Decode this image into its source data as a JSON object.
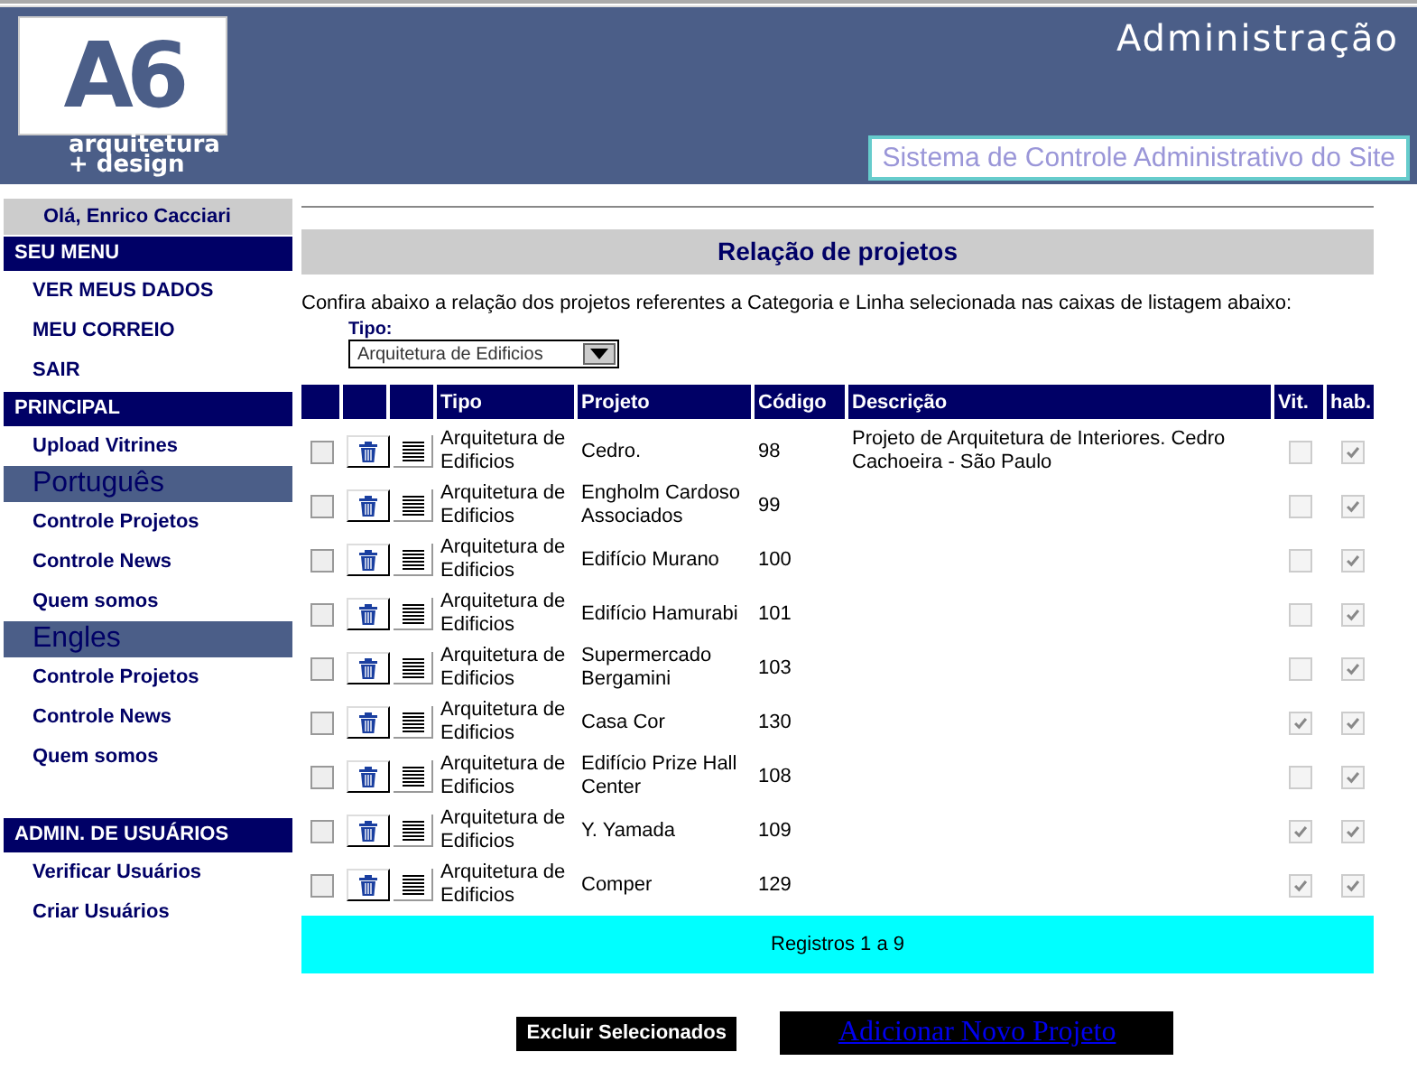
{
  "header": {
    "logo_mark": "A6",
    "logo_line_1": "arquitetura",
    "logo_line_2": "+ design",
    "title": "Administração",
    "subtitle": "Sistema de Controle Administrativo do Site"
  },
  "sidebar": {
    "greeting": "Olá, Enrico Cacciari",
    "sections": [
      {
        "kind": "menu",
        "title": "SEU MENU",
        "items": [
          "VER MEUS DADOS",
          "MEU CORREIO",
          "SAIR"
        ]
      },
      {
        "kind": "menu",
        "title": "PRINCIPAL",
        "items": [
          "Upload Vitrines"
        ]
      },
      {
        "kind": "language",
        "title": "Português",
        "items": [
          "Controle Projetos",
          "Controle News",
          "Quem somos"
        ]
      },
      {
        "kind": "language",
        "title": "Engles",
        "items": [
          "Controle Projetos",
          "Controle News",
          "Quem somos"
        ]
      },
      {
        "kind": "menu",
        "title": "ADMIN. DE USUÁRIOS",
        "items": [
          "Verificar Usuários",
          "Criar Usuários"
        ]
      }
    ]
  },
  "main": {
    "title": "Relação de projetos",
    "intro": "Confira abaixo a relação dos projetos referentes a Categoria e Linha selecionada nas caixas de listagem abaixo:",
    "filter_label": "Tipo:",
    "filter_value": "Arquitetura de Edificios",
    "table": {
      "columns": [
        "Tipo",
        "Projeto",
        "Código",
        "Descrição",
        "Vit.",
        "hab."
      ],
      "rows": [
        {
          "selected": false,
          "tipo": "Arquitetura de Edificios",
          "projeto": "Cedro.",
          "codigo": "98",
          "descricao": "Projeto de Arquitetura de Interiores. Cedro Cachoeira - São Paulo",
          "vit": false,
          "hab": true
        },
        {
          "selected": false,
          "tipo": "Arquitetura de Edificios",
          "projeto": "Engholm Cardoso Associados",
          "codigo": "99",
          "vit": false,
          "hab": true
        },
        {
          "selected": false,
          "tipo": "Arquitetura de Edificios",
          "projeto": "Edifício Murano",
          "codigo": "100",
          "vit": false,
          "hab": true
        },
        {
          "selected": false,
          "tipo": "Arquitetura de Edificios",
          "projeto": "Edifício Hamurabi",
          "codigo": "101",
          "vit": false,
          "hab": true
        },
        {
          "selected": false,
          "tipo": "Arquitetura de Edificios",
          "projeto": "Supermercado Bergamini",
          "codigo": "103",
          "vit": false,
          "hab": true
        },
        {
          "selected": false,
          "tipo": "Arquitetura de Edificios",
          "projeto": "Casa Cor",
          "codigo": "130",
          "vit": true,
          "hab": true
        },
        {
          "selected": false,
          "tipo": "Arquitetura de Edificios",
          "projeto": "Edifício Prize Hall Center",
          "codigo": "108",
          "vit": false,
          "hab": true
        },
        {
          "selected": false,
          "tipo": "Arquitetura de Edificios",
          "projeto": "Y. Yamada",
          "codigo": "109",
          "vit": true,
          "hab": true
        },
        {
          "selected": false,
          "tipo": "Arquitetura de Edificios",
          "projeto": "Comper",
          "codigo": "129",
          "vit": true,
          "hab": true
        }
      ]
    },
    "records": "Registros 1 a 9",
    "delete_button": "Excluir Selecionados",
    "add_link": "Adicionar Novo Projeto"
  }
}
